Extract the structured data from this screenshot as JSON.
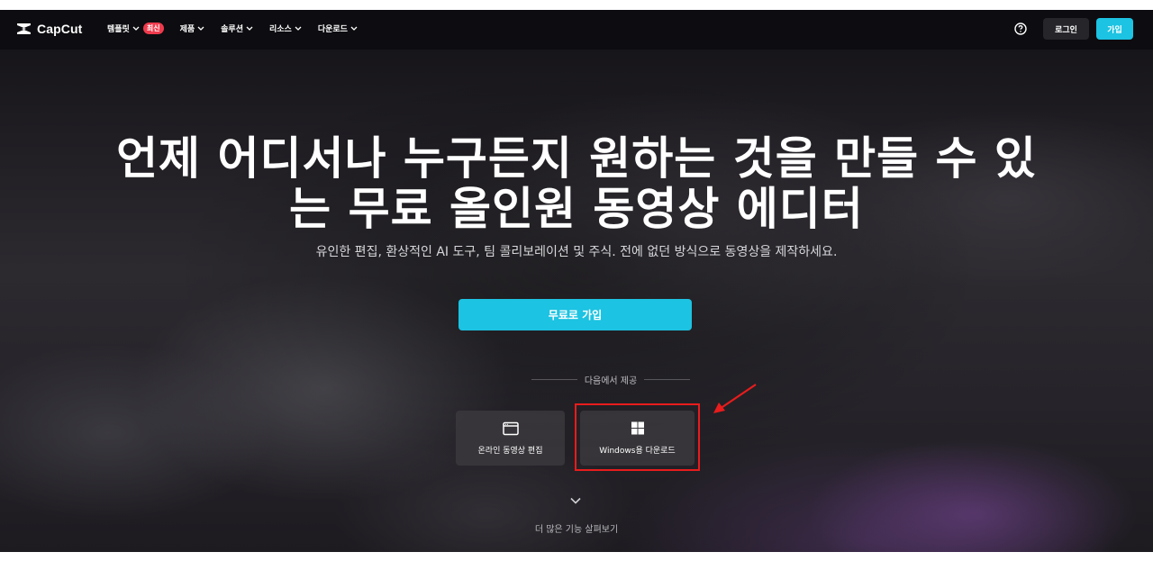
{
  "nav": {
    "logo_text": "CapCut",
    "items": [
      {
        "label": "템플릿",
        "badge": "최신"
      },
      {
        "label": "제품"
      },
      {
        "label": "솔루션"
      },
      {
        "label": "리소스"
      },
      {
        "label": "다운로드"
      }
    ],
    "login_label": "로그인",
    "signup_label": "가입",
    "accent_color": "#1cc3e2",
    "badge_color": "#ef3b4d"
  },
  "hero": {
    "title_line1": "언제 어디서나 누구든지 원하는 것을 만들 수 있",
    "title_line2": "는 무료 올인원 동영상 에디터",
    "subtitle": "유인한 편집, 환상적인 AI 도구, 팀 콜리보레이션 및 주식. 전에 없던 방식으로 동영상을 제작하세요.",
    "cta_label": "무료로 가입"
  },
  "offered": {
    "label": "다음에서 제공",
    "cards": [
      {
        "label": "온라인 동영상 편집",
        "icon": "browser-window-icon"
      },
      {
        "label": "Windows용 다운로드",
        "icon": "windows-logo-icon"
      }
    ]
  },
  "more": {
    "label": "더 많은 기능 살펴보기",
    "icon": "chevron-down-icon"
  },
  "annotation": {
    "highlight_color": "#e81c1c"
  }
}
